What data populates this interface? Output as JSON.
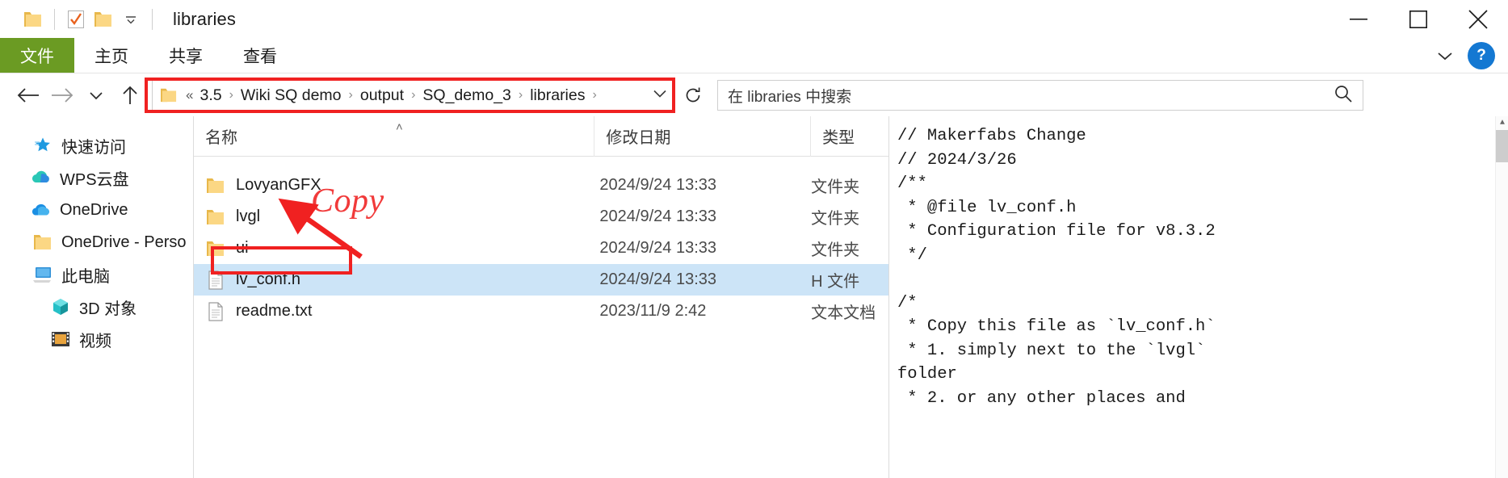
{
  "window": {
    "title": "libraries",
    "quick_access_icons": [
      "folder-icon",
      "properties-icon",
      "new-folder-icon",
      "customize-caret-icon"
    ],
    "caption_buttons": [
      {
        "name": "minimize",
        "glyph": "—"
      },
      {
        "name": "maximize",
        "glyph": "□"
      },
      {
        "name": "close",
        "glyph": "✕"
      }
    ]
  },
  "ribbon": {
    "tabs": [
      {
        "label": "文件",
        "active": true
      },
      {
        "label": "主页",
        "active": false
      },
      {
        "label": "共享",
        "active": false
      },
      {
        "label": "查看",
        "active": false
      }
    ],
    "file_tab_color": "#6b9b23",
    "collapse_icon": "chevron-down-icon",
    "help_label": "?"
  },
  "address": {
    "back_icon": "arrow-left-icon",
    "forward_icon": "arrow-right-icon",
    "recent_icon": "chevron-down-icon",
    "up_icon": "arrow-up-icon",
    "folder_icon": "folder-icon",
    "overflow": "«",
    "crumbs": [
      "3.5",
      "Wiki SQ demo",
      "output",
      "SQ_demo_3",
      "libraries"
    ],
    "separator": "›",
    "dropdown_icon": "chevron-down-icon",
    "refresh_icon": "refresh-icon",
    "highlight_color": "#f02121"
  },
  "search": {
    "placeholder": "在 libraries 中搜索",
    "icon": "search-icon"
  },
  "nav_pane": {
    "items": [
      {
        "label": "快速访问",
        "icon": "star-pin-icon",
        "indent": 40
      },
      {
        "label": "WPS云盘",
        "icon": "cloud-green-icon",
        "indent": 38
      },
      {
        "label": "OneDrive",
        "icon": "cloud-blue-icon",
        "indent": 38
      },
      {
        "label": "OneDrive - Perso",
        "icon": "folder-icon",
        "indent": 40
      },
      {
        "label": "此电脑",
        "icon": "computer-icon",
        "indent": 40
      },
      {
        "label": "3D 对象",
        "icon": "cube-icon",
        "indent": 62
      },
      {
        "label": "视频",
        "icon": "video-icon",
        "indent": 62
      }
    ]
  },
  "file_list": {
    "columns": [
      {
        "key": "name",
        "label": "名称"
      },
      {
        "key": "date",
        "label": "修改日期"
      },
      {
        "key": "type",
        "label": "类型"
      }
    ],
    "sort_indicator": "˄",
    "rows": [
      {
        "name": "LovyanGFX",
        "date": "2024/9/24 13:33",
        "type": "文件夹",
        "icon": "folder-icon",
        "selected": false
      },
      {
        "name": "lvgl",
        "date": "2024/9/24 13:33",
        "type": "文件夹",
        "icon": "folder-icon",
        "selected": false
      },
      {
        "name": "ui",
        "date": "2024/9/24 13:33",
        "type": "文件夹",
        "icon": "folder-icon",
        "selected": false
      },
      {
        "name": "lv_conf.h",
        "date": "2024/9/24 13:33",
        "type": "H 文件",
        "icon": "file-icon",
        "selected": true
      },
      {
        "name": "readme.txt",
        "date": "2023/11/9 2:42",
        "type": "文本文档",
        "icon": "file-icon",
        "selected": false
      }
    ]
  },
  "annotations": {
    "copy_label": "Copy",
    "arrow": "arrow-pointing-to-lvgl",
    "color": "#f13a3a"
  },
  "preview_pane": {
    "lines": [
      "// Makerfabs Change",
      "// 2024/3/26",
      "/**",
      " * @file lv_conf.h",
      " * Configuration file for v8.3.2",
      " */",
      "",
      "/*",
      " * Copy this file as `lv_conf.h`",
      " * 1. simply next to the `lvgl`",
      "folder",
      " * 2. or any other places and"
    ],
    "scrollbar": {
      "up": "▲",
      "down": "▼"
    }
  }
}
